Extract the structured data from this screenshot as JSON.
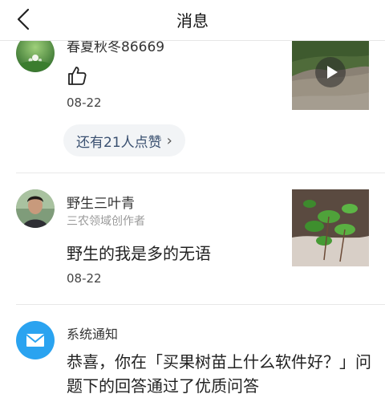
{
  "header": {
    "title": "消息"
  },
  "messages": [
    {
      "user": "春夏秋冬86669",
      "date": "08-22",
      "likes_label": "还有21人点赞"
    },
    {
      "user": "野生三叶青",
      "role": "三农领域创作者",
      "text": "野生的我是多的无语",
      "date": "08-22"
    }
  ],
  "notice": {
    "sender": "系统通知",
    "text": "恭喜，你在「买果树苗上什么软件好？」问题下的回答通过了优质问答"
  },
  "colors": {
    "accent": "#3a5070",
    "notice_icon": "#2aa3f0"
  }
}
